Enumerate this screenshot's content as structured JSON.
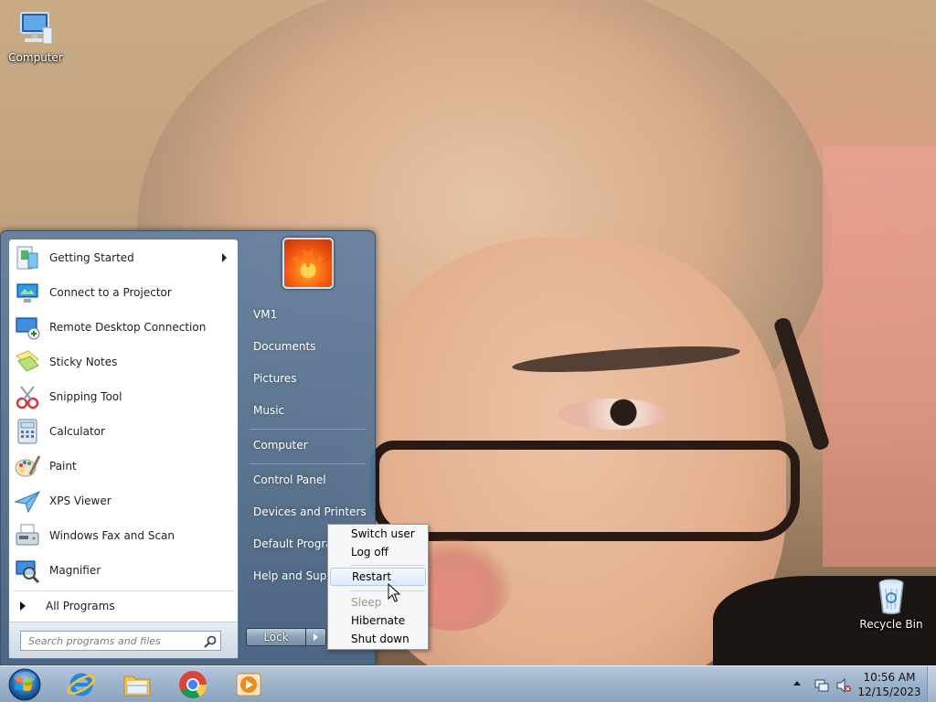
{
  "desktop": {
    "icons": [
      {
        "label": "Computer"
      },
      {
        "label": "Recycle Bin"
      }
    ]
  },
  "start_menu": {
    "programs": [
      {
        "label": "Getting Started",
        "icon": "getting-started-icon",
        "has_submenu": true
      },
      {
        "label": "Connect to a Projector",
        "icon": "projector-icon"
      },
      {
        "label": "Remote Desktop Connection",
        "icon": "remote-desktop-icon"
      },
      {
        "label": "Sticky Notes",
        "icon": "sticky-notes-icon"
      },
      {
        "label": "Snipping Tool",
        "icon": "snipping-tool-icon"
      },
      {
        "label": "Calculator",
        "icon": "calculator-icon"
      },
      {
        "label": "Paint",
        "icon": "paint-icon"
      },
      {
        "label": "XPS Viewer",
        "icon": "xps-viewer-icon"
      },
      {
        "label": "Windows Fax and Scan",
        "icon": "fax-scan-icon"
      },
      {
        "label": "Magnifier",
        "icon": "magnifier-icon"
      }
    ],
    "all_programs_label": "All Programs",
    "search_placeholder": "Search programs and files",
    "right_links": [
      {
        "label": "VM1"
      },
      {
        "label": "Documents"
      },
      {
        "label": "Pictures"
      },
      {
        "label": "Music"
      },
      {
        "label": "Computer"
      },
      {
        "label": "Control Panel"
      },
      {
        "label": "Devices and Printers"
      },
      {
        "label": "Default Programs"
      },
      {
        "label": "Help and Support"
      }
    ],
    "lock_label": "Lock"
  },
  "power_menu": {
    "items": [
      {
        "label": "Switch user",
        "state": "enabled"
      },
      {
        "label": "Log off",
        "state": "enabled"
      },
      {
        "label": "Restart",
        "state": "highlighted"
      },
      {
        "label": "Sleep",
        "state": "disabled"
      },
      {
        "label": "Hibernate",
        "state": "enabled"
      },
      {
        "label": "Shut down",
        "state": "enabled"
      }
    ]
  },
  "taskbar": {
    "pinned": [
      {
        "name": "internet-explorer-icon"
      },
      {
        "name": "windows-explorer-icon"
      },
      {
        "name": "chrome-icon"
      },
      {
        "name": "media-player-icon"
      }
    ],
    "clock": {
      "time": "10:56 AM",
      "date": "12/15/2023"
    },
    "tray_icons": [
      "network-icon",
      "volume-muted-icon"
    ]
  }
}
